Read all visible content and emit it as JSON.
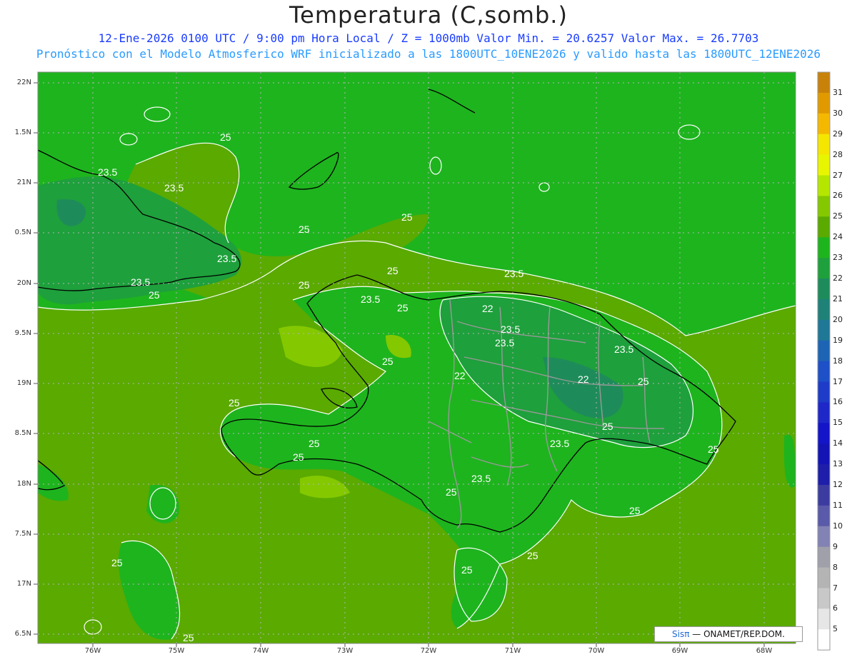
{
  "header": {
    "title": "Temperatura (C,somb.)",
    "line1": "12-Ene-2026  0100 UTC / 9:00 pm Hora Local / Z = 1000mb   Valor Min. = 20.6257  Valor Max. = 26.7703",
    "line2": "Pronóstico con el Modelo Atmosferico WRF inicializado a las 1800UTC_10ENE2026 y valido hasta las  1800UTC_12ENE2026"
  },
  "axes": {
    "lat_labels": [
      "22N",
      "1.5N",
      "21N",
      "0.5N",
      "20N",
      "9.5N",
      "19N",
      "8.5N",
      "18N",
      "7.5N",
      "17N",
      "6.5N"
    ],
    "lon_labels": [
      "76W",
      "75W",
      "74W",
      "73W",
      "72W",
      "71W",
      "70W",
      "69W",
      "68W"
    ]
  },
  "colorbar": {
    "labels": [
      "31",
      "30",
      "29",
      "28",
      "27",
      "26",
      "25",
      "24",
      "23",
      "22",
      "21",
      "20",
      "19",
      "18",
      "17",
      "16",
      "15",
      "14",
      "13",
      "12",
      "11",
      "10",
      "9",
      "8",
      "7",
      "6",
      "5"
    ],
    "colors": [
      "#c8820a",
      "#e09a00",
      "#f5b800",
      "#f5e600",
      "#e8f500",
      "#b4e600",
      "#84c800",
      "#5aaa00",
      "#1eb41e",
      "#1ea03c",
      "#1e8c5a",
      "#1e8278",
      "#1e7896",
      "#1e64b4",
      "#1e50c8",
      "#1e3cc8",
      "#1e28c8",
      "#1414c8",
      "#1414b4",
      "#1e1eaa",
      "#3c3ca0",
      "#5a5aaa",
      "#8282b4",
      "#a0a0aa",
      "#b4b4b4",
      "#c8c8c8",
      "#e6e6e6",
      "#ffffff"
    ]
  },
  "contour_labels": [
    "23.5",
    "23.5",
    "25",
    "25",
    "23.5",
    "23.5",
    "25",
    "25",
    "25",
    "25",
    "23.5",
    "23.5",
    "25",
    "22",
    "23.5",
    "23.5",
    "25",
    "22",
    "23.5",
    "25",
    "22",
    "25",
    "25",
    "23.5",
    "25",
    "25",
    "25",
    "23.5",
    "25",
    "25",
    "25",
    "25",
    "25",
    "25",
    "25"
  ],
  "credit": {
    "brand": "Sisπ",
    "text": " —  ONAMET/REP.DOM."
  }
}
